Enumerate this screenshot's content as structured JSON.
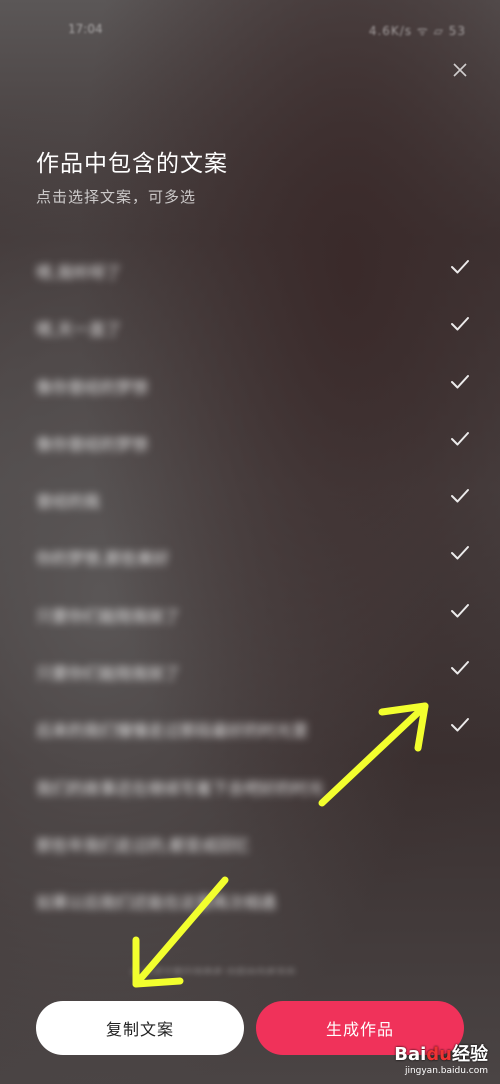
{
  "status_bar": {
    "time": "17:04",
    "icons": "4.6K/s ᯤ ▱ 53"
  },
  "header": {
    "title": "作品中包含的文案",
    "subtitle": "点击选择文案，可多选"
  },
  "list": {
    "items": [
      {
        "label": "嗯,我听呀了",
        "checked": true
      },
      {
        "label": "嗯,天一直了",
        "checked": true
      },
      {
        "label": "像你曾经的梦想",
        "checked": true
      },
      {
        "label": "像你曾经的梦想",
        "checked": true
      },
      {
        "label": "曾经的我",
        "checked": true
      },
      {
        "label": "你的梦想,那些美好",
        "checked": true
      },
      {
        "label": "只要你们能陪我就了",
        "checked": true
      },
      {
        "label": "只要你们能陪我就了",
        "checked": true
      },
      {
        "label": "后来的我们慢慢走过那段最好的时光里",
        "checked": true
      },
      {
        "label": "我们的故事还在继续写着下去吧好的时光",
        "checked": false
      },
      {
        "label": "那些年我们走过的,都变成回忆",
        "checked": false
      },
      {
        "label": "如果以后我们还能在这里再次相遇",
        "checked": false
      }
    ]
  },
  "footnote": "AI 生成文案仅供参考 内容由作者发布",
  "buttons": {
    "copy": "复制文案",
    "generate": "生成作品"
  },
  "watermark": {
    "logo_a": "Bai",
    "logo_b": "du",
    "logo_c": "经验",
    "url": "jingyan.baidu.com"
  },
  "colors": {
    "accent": "#f0325a",
    "arrow": "#f2ff2e"
  }
}
